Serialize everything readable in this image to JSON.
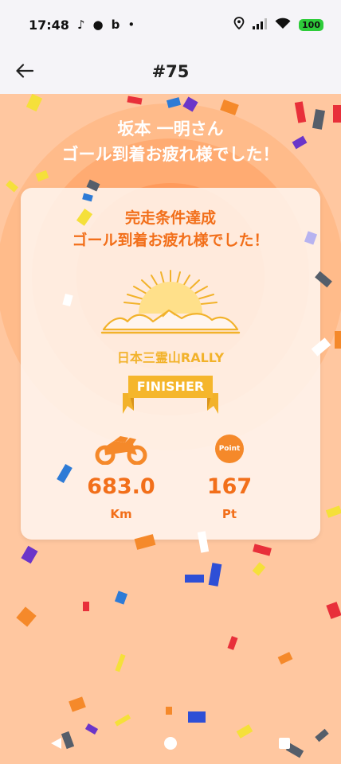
{
  "status": {
    "time": "17:48",
    "battery": "100"
  },
  "header": {
    "title": "#75"
  },
  "congrats": {
    "name_line": "坂本 一明さん",
    "message": "ゴール到着お疲れ様でした！"
  },
  "card": {
    "title_line1": "完走条件達成",
    "title_line2": "ゴール到着お疲れ様でした！",
    "rally_name": "日本三霊山RALLY",
    "badge": "FINISHER",
    "distance": {
      "value": "683.0",
      "unit": "Km"
    },
    "points": {
      "icon_label": "Point",
      "value": "167",
      "unit": "Pt"
    }
  },
  "colors": {
    "accent": "#f26f1a",
    "gold": "#f2b22a",
    "background": "#ffc7a0"
  }
}
